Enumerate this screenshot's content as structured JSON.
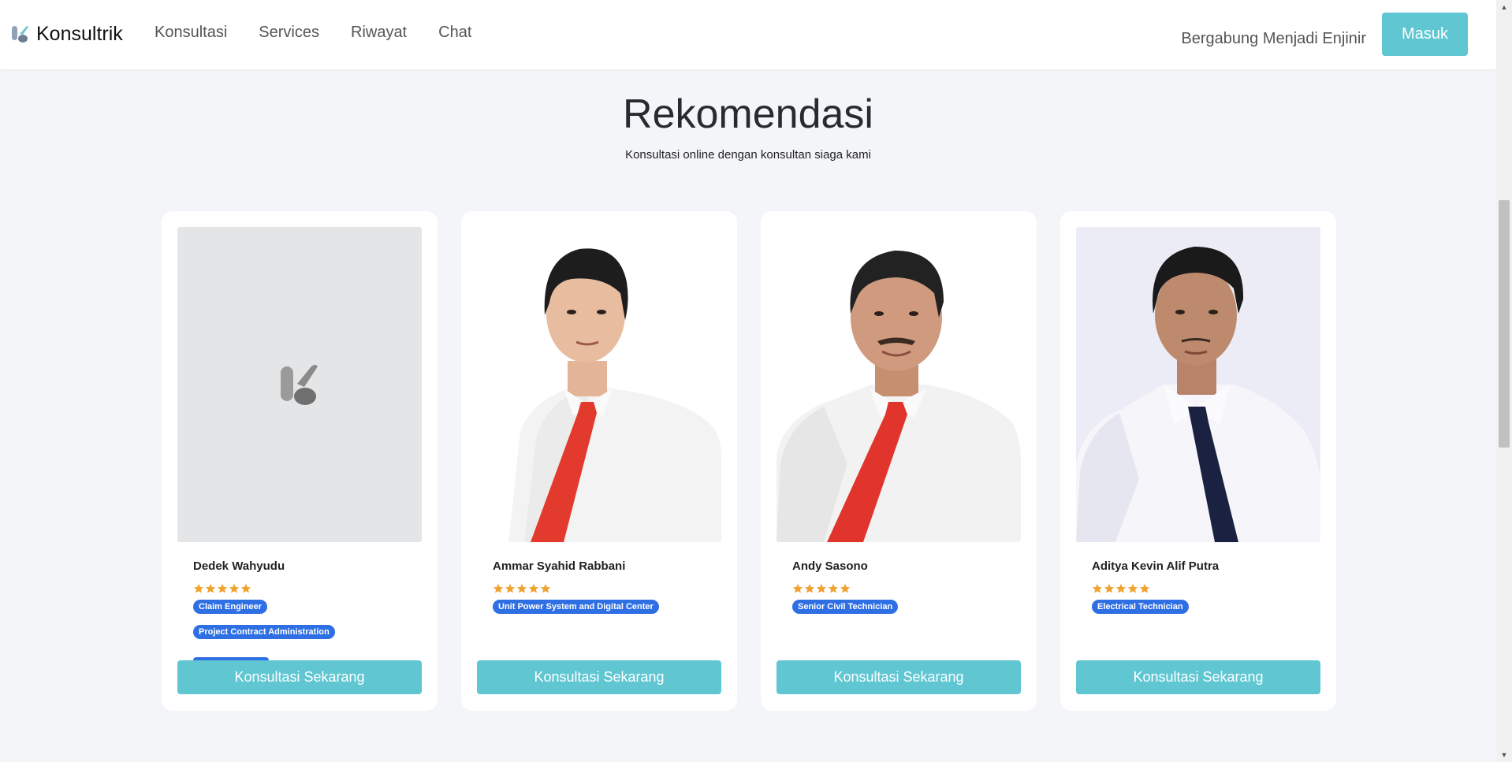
{
  "navbar": {
    "brand": "Konsultrik",
    "links": [
      {
        "label": "Konsultasi"
      },
      {
        "label": "Services"
      },
      {
        "label": "Riwayat"
      },
      {
        "label": "Chat"
      }
    ],
    "join_label": "Bergabung Menjadi Enjinir",
    "login_label": "Masuk"
  },
  "section": {
    "title": "Rekomendasi",
    "subtitle": "Konsultasi online dengan konsultan siaga kami"
  },
  "consultants": [
    {
      "name": "Dedek Wahyudu",
      "rating": 5,
      "tags": [
        "Claim Engineer",
        "Project Contract Administration"
      ],
      "photo": "placeholder-logo",
      "button_label": "Konsultasi Sekarang"
    },
    {
      "name": "Ammar Syahid Rabbani",
      "rating": 5,
      "tags": [
        "Unit Power System and Digital Center"
      ],
      "photo": "man-red-tie",
      "button_label": "Konsultasi Sekarang"
    },
    {
      "name": "Andy Sasono",
      "rating": 5,
      "tags": [
        "Senior Civil Technician"
      ],
      "photo": "man-red-tie",
      "button_label": "Konsultasi Sekarang"
    },
    {
      "name": "Aditya Kevin Alif Putra",
      "rating": 5,
      "tags": [
        "Electrical Technician"
      ],
      "photo": "man-navy-tie",
      "button_label": "Konsultasi Sekarang"
    }
  ],
  "colors": {
    "accent": "#5fc6d2",
    "tag": "#2f6fe4",
    "star": "#f0a32f",
    "background": "#f4f5f8"
  },
  "icons": {
    "brand": "konsultrik-logo-icon",
    "rating": "star-icon"
  }
}
